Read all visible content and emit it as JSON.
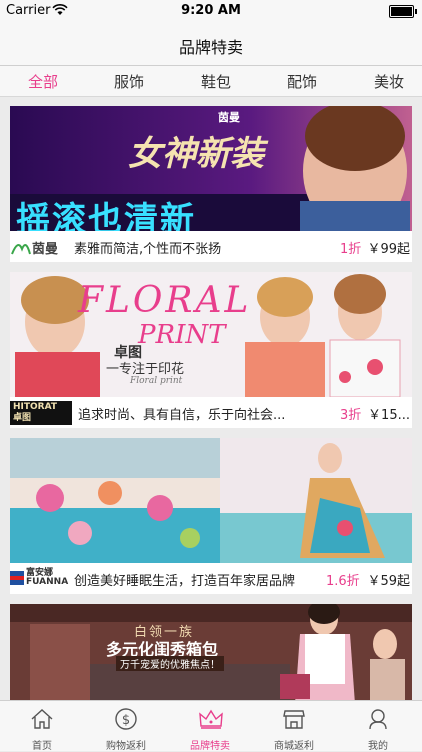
{
  "status": {
    "carrier": "Carrier",
    "time": "9:20 AM"
  },
  "nav": {
    "title": "品牌特卖"
  },
  "tabs": [
    {
      "label": "全部"
    },
    {
      "label": "服饰"
    },
    {
      "label": "鞋包"
    },
    {
      "label": "配饰"
    },
    {
      "label": "美妆"
    }
  ],
  "cards": [
    {
      "banner_text": {
        "brand": "茵曼",
        "line1": "女神新装",
        "line2": "摇滚也清新"
      },
      "logo_text": "茵曼",
      "slogan": "素雅而简洁,个性而不张扬",
      "discount": "1折",
      "price": "￥99起"
    },
    {
      "banner_text": {
        "line1": "FLORAL",
        "line2": "PRINT",
        "line3": "卓图",
        "line4": "一专注于印花",
        "line5": "Floral print"
      },
      "logo_text": "HITORAT 卓图",
      "slogan": "追求时尚、具有自信，乐于向社会...",
      "discount": "3折",
      "price": "￥15..."
    },
    {
      "logo_text": "富安娜 FUANNA",
      "slogan": "创造美好睡眠生活，打造百年家居品牌",
      "discount": "1.6折",
      "price": "￥59起"
    },
    {
      "banner_text": {
        "line1": "白领一族",
        "line2": "多元化闺秀箱包",
        "line3": "万千宠爱的优雅焦点！"
      }
    }
  ],
  "tabbar": [
    {
      "label": "首页",
      "icon": "home-icon"
    },
    {
      "label": "购物返利",
      "icon": "dollar-coin-icon"
    },
    {
      "label": "品牌特卖",
      "icon": "crown-icon"
    },
    {
      "label": "商城返利",
      "icon": "shop-icon"
    },
    {
      "label": "我的",
      "icon": "user-icon"
    }
  ],
  "colors": {
    "accent": "#e83e8c"
  }
}
